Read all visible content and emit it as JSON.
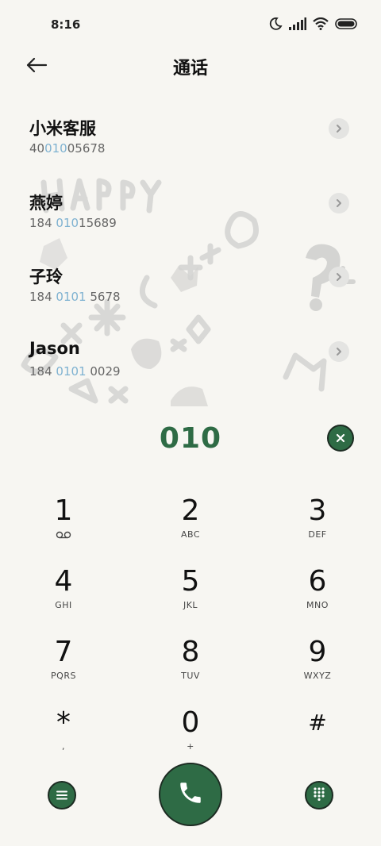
{
  "status_bar": {
    "time": "8:16",
    "icons": [
      "moon-icon",
      "signal-icon",
      "wifi-icon",
      "battery-icon"
    ]
  },
  "header": {
    "title": "通话",
    "back_icon": "arrow-left-icon"
  },
  "results": [
    {
      "name": "小米客服",
      "number_parts": [
        "40",
        "010",
        "05678"
      ]
    },
    {
      "name": "燕婷",
      "number_parts": [
        "184 ",
        "010",
        "15689"
      ]
    },
    {
      "name": "子玲",
      "number_parts": [
        "184 ",
        "0101",
        " 5678"
      ]
    },
    {
      "name": "Jason",
      "number_parts": [
        "184 ",
        "0101",
        " 0029"
      ]
    }
  ],
  "dialer": {
    "entered_digits": "010"
  },
  "keypad": [
    {
      "digit": "1",
      "sub": "",
      "sub_icon": "voicemail-icon"
    },
    {
      "digit": "2",
      "sub": "ABC"
    },
    {
      "digit": "3",
      "sub": "DEF"
    },
    {
      "digit": "4",
      "sub": "GHI"
    },
    {
      "digit": "5",
      "sub": "JKL"
    },
    {
      "digit": "6",
      "sub": "MNO"
    },
    {
      "digit": "7",
      "sub": "PQRS"
    },
    {
      "digit": "8",
      "sub": "TUV"
    },
    {
      "digit": "9",
      "sub": "WXYZ"
    },
    {
      "digit": "*",
      "sub": ","
    },
    {
      "digit": "0",
      "sub": "+"
    },
    {
      "digit": "#",
      "sub": ""
    }
  ],
  "colors": {
    "accent": "#2e6b45",
    "highlight": "#7fb2d1",
    "background": "#f7f6f2"
  }
}
